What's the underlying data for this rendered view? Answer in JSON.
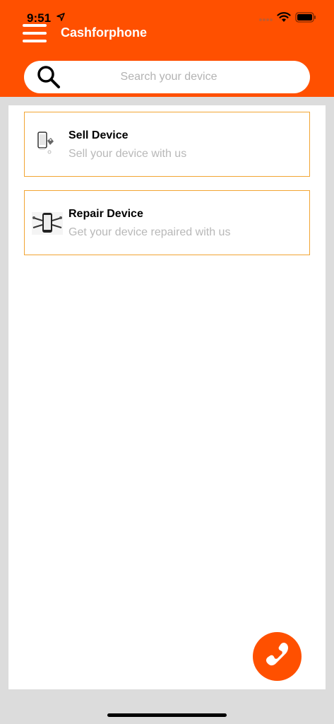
{
  "status_bar": {
    "time": "9:51"
  },
  "header": {
    "title": "Cashforphone",
    "menu_icon": "hamburger-menu-icon"
  },
  "search": {
    "placeholder": "Search your device",
    "icon": "search-icon"
  },
  "cards": [
    {
      "title": "Sell Device",
      "subtitle": "Sell your device with us",
      "icon": "sell-phone-icon"
    },
    {
      "title": "Repair Device",
      "subtitle": "Get your device repaired with us",
      "icon": "repair-phone-icon"
    }
  ],
  "fab": {
    "icon": "phone-call-icon"
  },
  "colors": {
    "brand": "#ff5000",
    "card_border": "#f2a533",
    "subtitle": "#b8b8b8",
    "background": "#dcdcdc"
  }
}
